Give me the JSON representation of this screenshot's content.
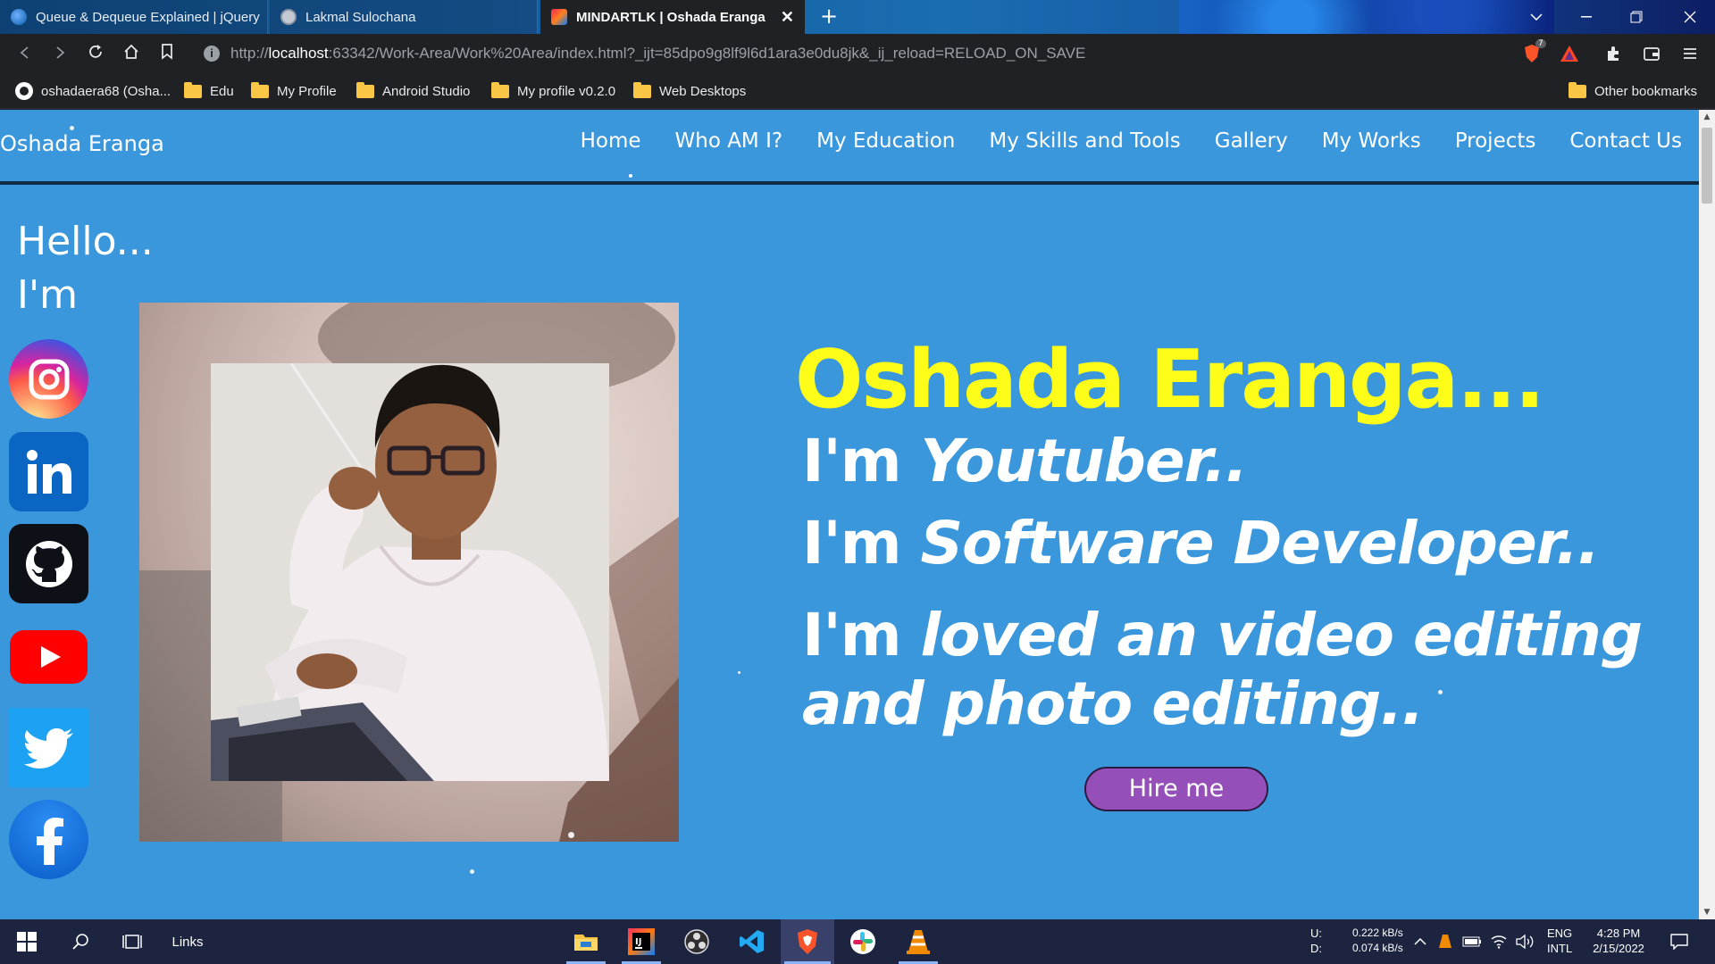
{
  "browser": {
    "tabs": [
      {
        "title": "Queue & Dequeue Explained | jQuery",
        "active": false
      },
      {
        "title": "Lakmal Sulochana",
        "active": false
      },
      {
        "title": "MINDARTLK | Oshada Eranga",
        "active": true
      }
    ],
    "close_glyph": "✕",
    "new_tab_glyph": "+",
    "url": {
      "scheme": "http://",
      "host": "localhost",
      "rest": ":63342/Work-Area/Work%20Area/index.html?_ijt=85dpo9g8lf9l6d1ara3e0du8jk&_ij_reload=RELOAD_ON_SAVE"
    },
    "brave_badge": "7",
    "bookmarks": [
      {
        "label": "oshadaera68 (Osha...",
        "icon": "github-icon"
      },
      {
        "label": "Edu",
        "icon": "folder-icon"
      },
      {
        "label": "My Profile",
        "icon": "folder-icon"
      },
      {
        "label": "Android Studio",
        "icon": "folder-icon"
      },
      {
        "label": "My profile v0.2.0",
        "icon": "folder-icon"
      },
      {
        "label": "Web Desktops",
        "icon": "folder-icon"
      }
    ],
    "other_bookmarks": "Other bookmarks"
  },
  "site": {
    "brand": "Oshada Eranga",
    "nav": [
      "Home",
      "Who AM I?",
      "My Education",
      "My Skills and Tools",
      "Gallery",
      "My Works",
      "Projects",
      "Contact Us"
    ],
    "hello": "Hello...",
    "im": "I'm",
    "social": [
      {
        "name": "instagram-icon",
        "color": "#d6249f"
      },
      {
        "name": "linkedin-icon",
        "color": "#0a66c2"
      },
      {
        "name": "github-icon",
        "color": "#0d1117"
      },
      {
        "name": "youtube-icon",
        "color": "#ff0000"
      },
      {
        "name": "twitter-icon",
        "color": "#1da1f2"
      },
      {
        "name": "facebook-icon",
        "color": "#1877f2"
      }
    ],
    "hero_name": "Oshada Eranga...",
    "lines": [
      {
        "prefix": "I'm ",
        "emph": "Youtuber.."
      },
      {
        "prefix": "I'm ",
        "emph": "Software Developer.."
      },
      {
        "prefix": "I'm ",
        "emph": "loved an video editing"
      },
      {
        "prefix": "",
        "emph": "and photo editing.."
      }
    ],
    "hire_label": "Hire me",
    "colors": {
      "background": "#3a97dc",
      "name": "#fdfd19",
      "button": "#9450b8"
    }
  },
  "taskbar": {
    "links_label": "Links",
    "net_up_label": "U:",
    "net_down_label": "D:",
    "net_up": "0.222 kB/s",
    "net_down": "0.074 kB/s",
    "lang": "ENG",
    "layout": "INTL",
    "time": "4:28 PM",
    "date": "2/15/2022"
  }
}
